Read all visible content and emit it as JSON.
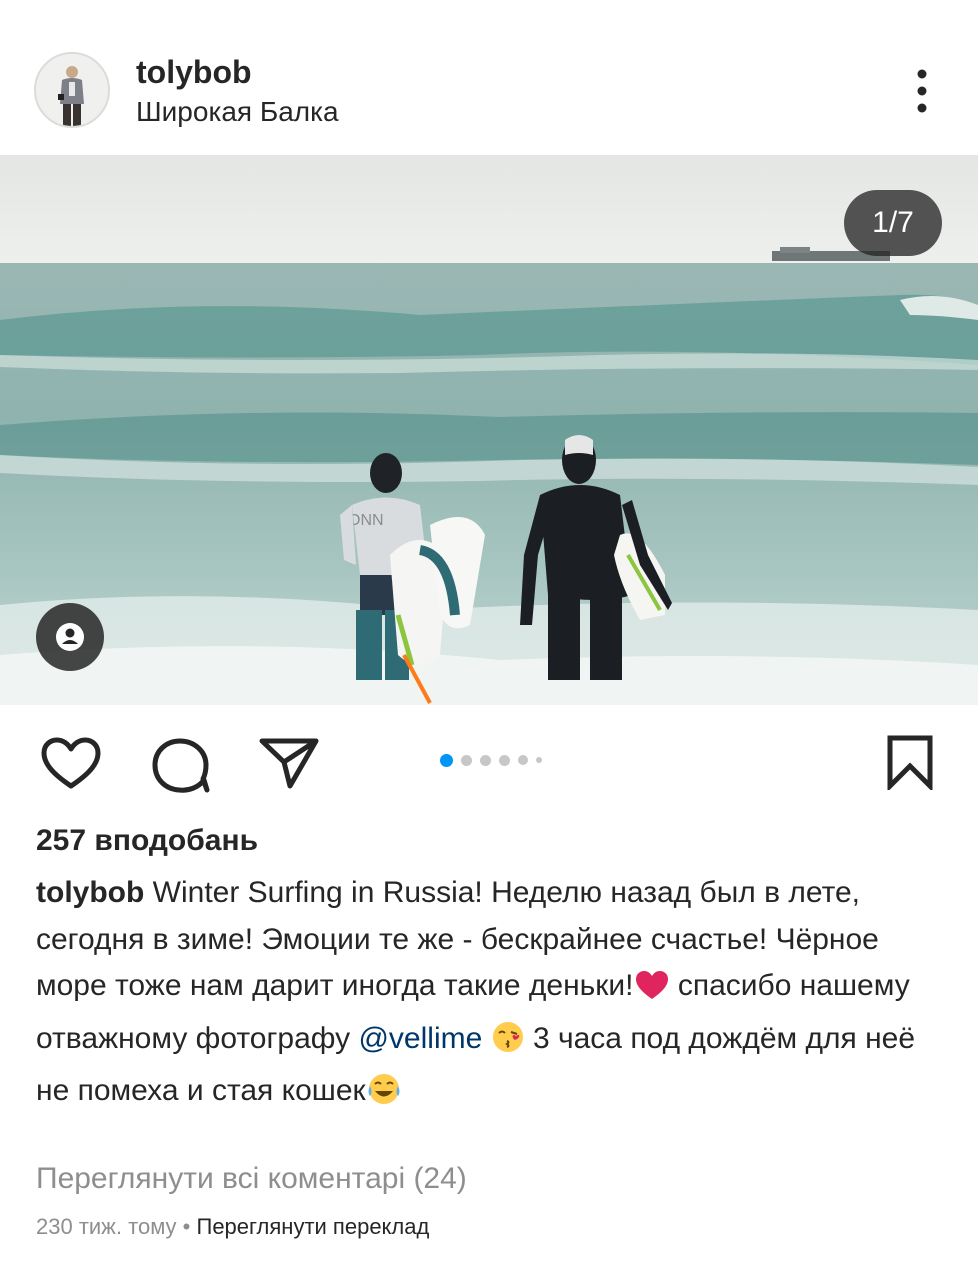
{
  "post": {
    "username": "tolybob",
    "location": "Широкая Балка",
    "image_counter": "1/7",
    "carousel": {
      "total": 7,
      "active_index": 0
    },
    "likes_text": "257 вподобань",
    "caption": {
      "username": "tolybob",
      "text_part1": " Winter Surfing in Russia! Неделю назад был в лете, сегодня в зиме! Эмоции те же - бескрайнее счастье! Чёрное море тоже нам дарит иногда такие деньки!",
      "text_part2": " спасибо нашему отважному фотографу ",
      "mention": "@vellime",
      "text_part3": " 3 часа под дождём для неё не помеха и стая кошек"
    },
    "view_comments": "Переглянути всі коментарі (24)",
    "time_ago": "230 тиж. тому",
    "separator": " • ",
    "translate": "Переглянути переклад"
  },
  "icons": {
    "more": "more-vertical-icon",
    "like": "heart-icon",
    "comment": "comment-icon",
    "share": "send-icon",
    "save": "bookmark-icon",
    "tags": "user-tag-icon"
  },
  "colors": {
    "text": "#262626",
    "muted": "#8e8e8e",
    "mention": "#00376b",
    "carousel_active": "#0095f6",
    "carousel_inactive": "#c7c7c7"
  }
}
